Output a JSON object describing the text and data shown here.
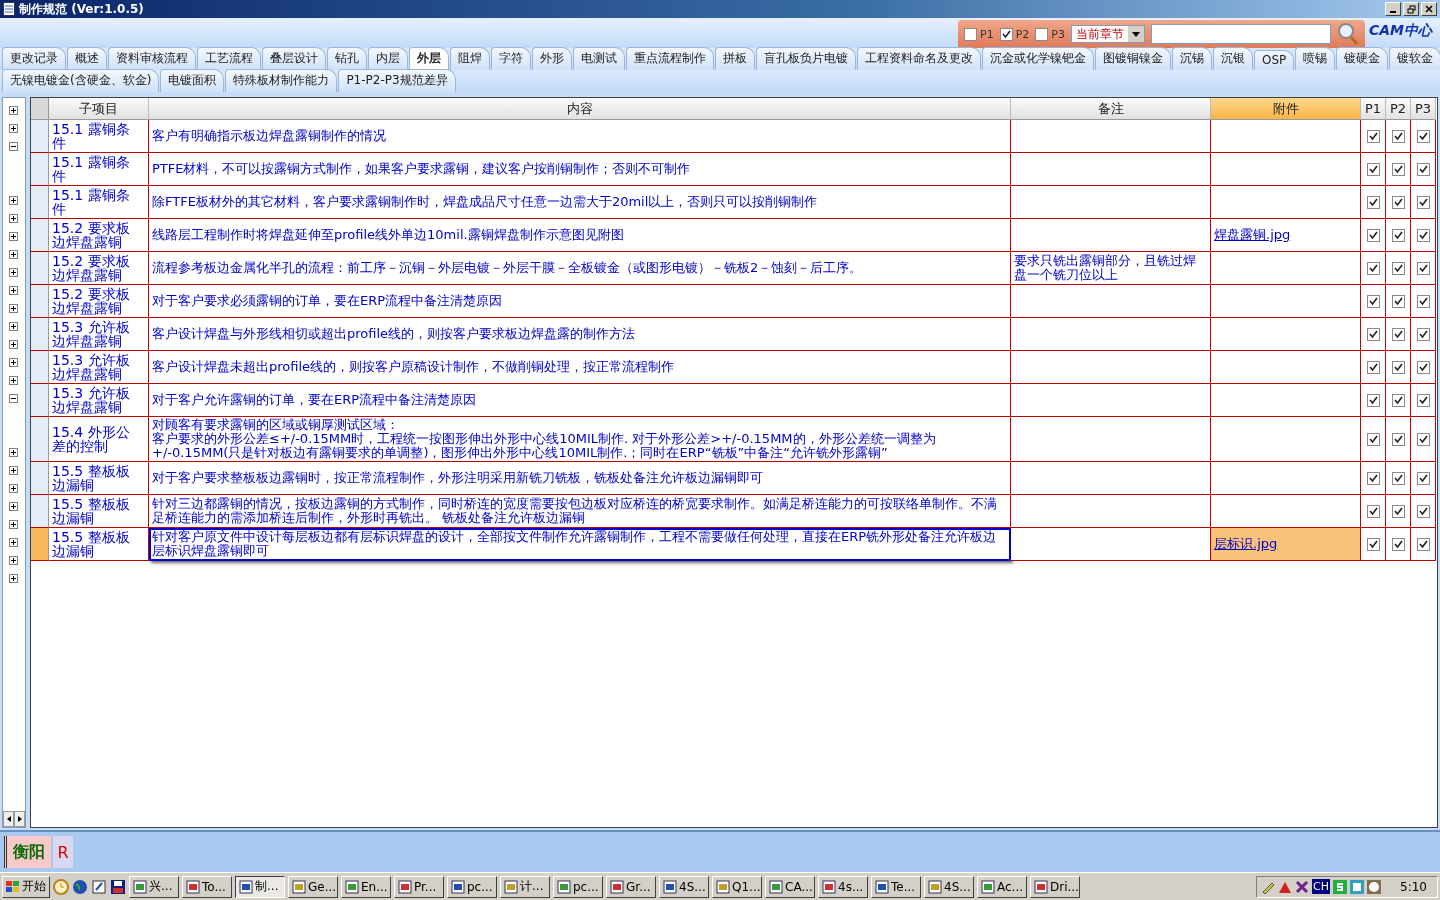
{
  "window": {
    "title": "制作规范 (Ver:1.0.5)"
  },
  "filter": {
    "options": [
      {
        "label": "P1",
        "checked": false
      },
      {
        "label": "P2",
        "checked": true
      },
      {
        "label": "P3",
        "checked": false
      }
    ],
    "scope": "当前章节",
    "logo": "CAM中心"
  },
  "tab_rows": [
    [
      {
        "label": "更改记录",
        "selected": false
      },
      {
        "label": "概述",
        "selected": false
      },
      {
        "label": "资料审核流程",
        "selected": false
      },
      {
        "label": "工艺流程",
        "selected": false
      },
      {
        "label": "叠层设计",
        "selected": false
      },
      {
        "label": "钻孔",
        "selected": false
      },
      {
        "label": "内层",
        "selected": false
      },
      {
        "label": "外层",
        "selected": true
      },
      {
        "label": "阻焊",
        "selected": false
      },
      {
        "label": "字符",
        "selected": false
      },
      {
        "label": "外形",
        "selected": false
      },
      {
        "label": "电测试",
        "selected": false
      },
      {
        "label": "重点流程制作",
        "selected": false
      },
      {
        "label": "拼板",
        "selected": false
      },
      {
        "label": "盲孔板负片电镀",
        "selected": false
      },
      {
        "label": "工程资料命名及更改",
        "selected": false
      },
      {
        "label": "沉金或化学镍钯金",
        "selected": false
      },
      {
        "label": "图镀铜镍金",
        "selected": false
      },
      {
        "label": "沉锡",
        "selected": false
      },
      {
        "label": "沉银",
        "selected": false
      },
      {
        "label": "OSP",
        "selected": false
      },
      {
        "label": "喷锡",
        "selected": false
      },
      {
        "label": "镀硬金",
        "selected": false
      },
      {
        "label": "镀软金",
        "selected": false
      }
    ],
    [
      {
        "label": "无镍电镀金(含硬金、软金)",
        "selected": false
      },
      {
        "label": "电镀面积",
        "selected": false
      },
      {
        "label": "特殊板材制作能力",
        "selected": false
      },
      {
        "label": "P1-P2-P3规范差异",
        "selected": false
      }
    ]
  ],
  "tree_groups": [
    {
      "nodes": [
        {
          "expanded": false
        },
        {
          "expanded": false
        },
        {
          "expanded": true
        }
      ]
    },
    {
      "nodes": [
        {
          "expanded": false
        },
        {
          "expanded": false
        },
        {
          "expanded": false
        },
        {
          "expanded": false
        },
        {
          "expanded": false
        },
        {
          "expanded": false
        },
        {
          "expanded": false
        },
        {
          "expanded": false
        },
        {
          "expanded": false
        },
        {
          "expanded": false
        },
        {
          "expanded": false
        },
        {
          "expanded": true
        }
      ]
    },
    {
      "nodes": [
        {
          "expanded": false
        },
        {
          "expanded": false
        },
        {
          "expanded": false
        },
        {
          "expanded": false
        },
        {
          "expanded": false
        },
        {
          "expanded": false
        },
        {
          "expanded": false
        },
        {
          "expanded": false
        }
      ]
    }
  ],
  "table": {
    "columns": [
      "子项目",
      "内容",
      "备注",
      "附件",
      "P1",
      "P2",
      "P3"
    ],
    "rows": [
      {
        "sub": "15.1 露铜条件",
        "content": "客户有明确指示板边焊盘露铜制作的情况",
        "note": "",
        "attachment": "",
        "p1": true,
        "p2": true,
        "p3": true,
        "selected": false
      },
      {
        "sub": "15.1 露铜条件",
        "content": "PTFE材料，不可以按露铜方式制作，如果客户要求露铜，建议客户按削铜制作；否则不可制作",
        "note": "",
        "attachment": "",
        "p1": true,
        "p2": true,
        "p3": true,
        "selected": false
      },
      {
        "sub": "15.1 露铜条件",
        "content": "除FTFE板材外的其它材料，客户要求露铜制作时，焊盘成品尺寸任意一边需大于20mil以上，否则只可以按削铜制作",
        "note": "",
        "attachment": "",
        "p1": true,
        "p2": true,
        "p3": true,
        "selected": false
      },
      {
        "sub": "15.2 要求板边焊盘露铜",
        "content": "线路层工程制作时将焊盘延伸至profile线外单边10mil.露铜焊盘制作示意图见附图",
        "note": "",
        "attachment": "焊盘露铜.jpg",
        "p1": true,
        "p2": true,
        "p3": true,
        "selected": false
      },
      {
        "sub": "15.2 要求板边焊盘露铜",
        "content": "流程参考板边金属化半孔的流程：前工序－沉铜－外层电镀－外层干膜－全板镀金（或图形电镀）－铣板2－蚀刻－后工序。",
        "note": "要求只铣出露铜部分，且铣过焊盘一个铣刀位以上",
        "attachment": "",
        "p1": true,
        "p2": true,
        "p3": true,
        "selected": false
      },
      {
        "sub": "15.2 要求板边焊盘露铜",
        "content": "对于客户要求必须露铜的订单，要在ERP流程中备注清楚原因",
        "note": "",
        "attachment": "",
        "p1": true,
        "p2": true,
        "p3": true,
        "selected": false
      },
      {
        "sub": "15.3 允许板边焊盘露铜",
        "content": "客户设计焊盘与外形线相切或超出profile线的，则按客户要求板边焊盘露的制作方法",
        "note": "",
        "attachment": "",
        "p1": true,
        "p2": true,
        "p3": true,
        "selected": false
      },
      {
        "sub": "15.3 允许板边焊盘露铜",
        "content": "客户设计焊盘未超出profile线的，则按客户原稿设计制作，不做削铜处理，按正常流程制作",
        "note": "",
        "attachment": "",
        "p1": true,
        "p2": true,
        "p3": true,
        "selected": false
      },
      {
        "sub": "15.3 允许板边焊盘露铜",
        "content": "对于客户允许露铜的订单，要在ERP流程中备注清楚原因",
        "note": "",
        "attachment": "",
        "p1": true,
        "p2": true,
        "p3": true,
        "selected": false
      },
      {
        "sub": "15.4 外形公差的控制",
        "content": [
          "对顾客有要求露铜的区域或铜厚测试区域：",
          "客户要求的外形公差≤+/-0.15MM时，工程统一按图形伸出外形中心线10MIL制作. 对于外形公差>+/-0.15MM的，外形公差统一调整为+/-0.15MM(只是针对板边有露铜要求的单调整)，图形伸出外形中心线10MIL制作.；同时在ERP“铣板”中备注“允许铣外形露铜”"
        ],
        "note": "",
        "attachment": "",
        "p1": true,
        "p2": true,
        "p3": true,
        "selected": false
      },
      {
        "sub": "15.5 整板板边漏铜",
        "content": "对于客户要求整板板边露铜时，按正常流程制作，外形注明采用新铣刀铣板，铣板处备注允许板边漏铜即可",
        "note": "",
        "attachment": "",
        "p1": true,
        "p2": true,
        "p3": true,
        "selected": false
      },
      {
        "sub": "15.5 整板板边漏铜",
        "content": "针对三边都露铜的情况，按板边露铜的方式制作，同时桥连的宽度需要按包边板对应桥连的桥宽要求制作。如满足桥连能力的可按联络单制作。不满足桥连能力的需添加桥连后制作，外形时再铣出。 铣板处备注允许板边漏铜",
        "note": "",
        "attachment": "",
        "p1": true,
        "p2": true,
        "p3": true,
        "selected": false
      },
      {
        "sub": "15.5 整板板边漏铜",
        "content": "针对客户原文件中设计每层板边都有层标识焊盘的设计，全部按文件制作允许露铜制作，工程不需要做任何处理，直接在ERP铣外形处备注允许板边层标识焊盘露铜即可",
        "note": "",
        "attachment": "层标识.jpg",
        "p1": true,
        "p2": true,
        "p3": true,
        "selected": true
      }
    ]
  },
  "site_bar": {
    "site": "衡阳",
    "mark": "R"
  },
  "taskbar": {
    "start": "开始",
    "tasks": [
      {
        "label": "兴...",
        "selected": false
      },
      {
        "label": "To...",
        "selected": false
      },
      {
        "label": "制...",
        "selected": true
      },
      {
        "label": "Ge...",
        "selected": false
      },
      {
        "label": "En...",
        "selected": false
      },
      {
        "label": "Pr...",
        "selected": false
      },
      {
        "label": "pc...",
        "selected": false
      },
      {
        "label": "计...",
        "selected": false
      },
      {
        "label": "pc...",
        "selected": false
      },
      {
        "label": "Gr...",
        "selected": false
      },
      {
        "label": "4S...",
        "selected": false
      },
      {
        "label": "Q1...",
        "selected": false
      },
      {
        "label": "CA...",
        "selected": false
      },
      {
        "label": "4s...",
        "selected": false
      },
      {
        "label": "Te...",
        "selected": false
      },
      {
        "label": "4S...",
        "selected": false
      },
      {
        "label": "Ac...",
        "selected": false
      },
      {
        "label": "Dri...",
        "selected": false
      }
    ],
    "ime": "CH",
    "clock": "5:10"
  }
}
